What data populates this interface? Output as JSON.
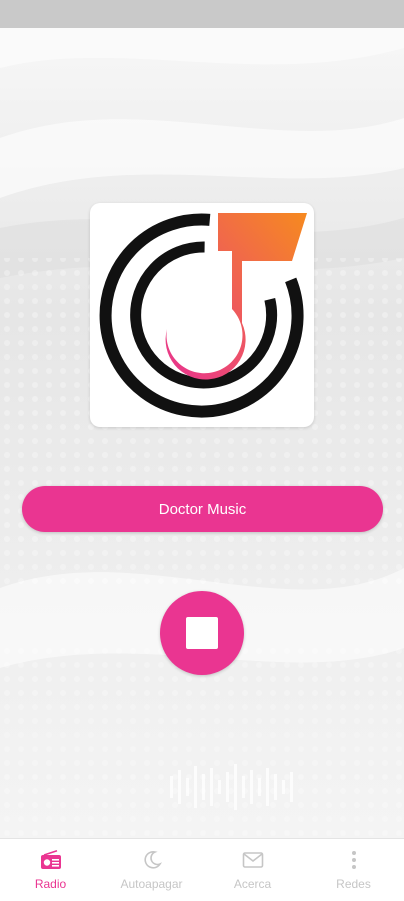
{
  "station": {
    "name": "Doctor Music"
  },
  "player": {
    "state_icon": "stop-icon"
  },
  "colors": {
    "accent": "#ea3591",
    "inactive": "#c6c6c6",
    "logo_gradient": [
      "#e8338f",
      "#f68a1f"
    ]
  },
  "nav": {
    "items": [
      {
        "label": "Radio",
        "icon": "radio-icon",
        "active": true
      },
      {
        "label": "Autoapagar",
        "icon": "moon-icon",
        "active": false
      },
      {
        "label": "Acerca",
        "icon": "mail-icon",
        "active": false
      },
      {
        "label": "Redes",
        "icon": "more-vert-icon",
        "active": false
      }
    ]
  }
}
